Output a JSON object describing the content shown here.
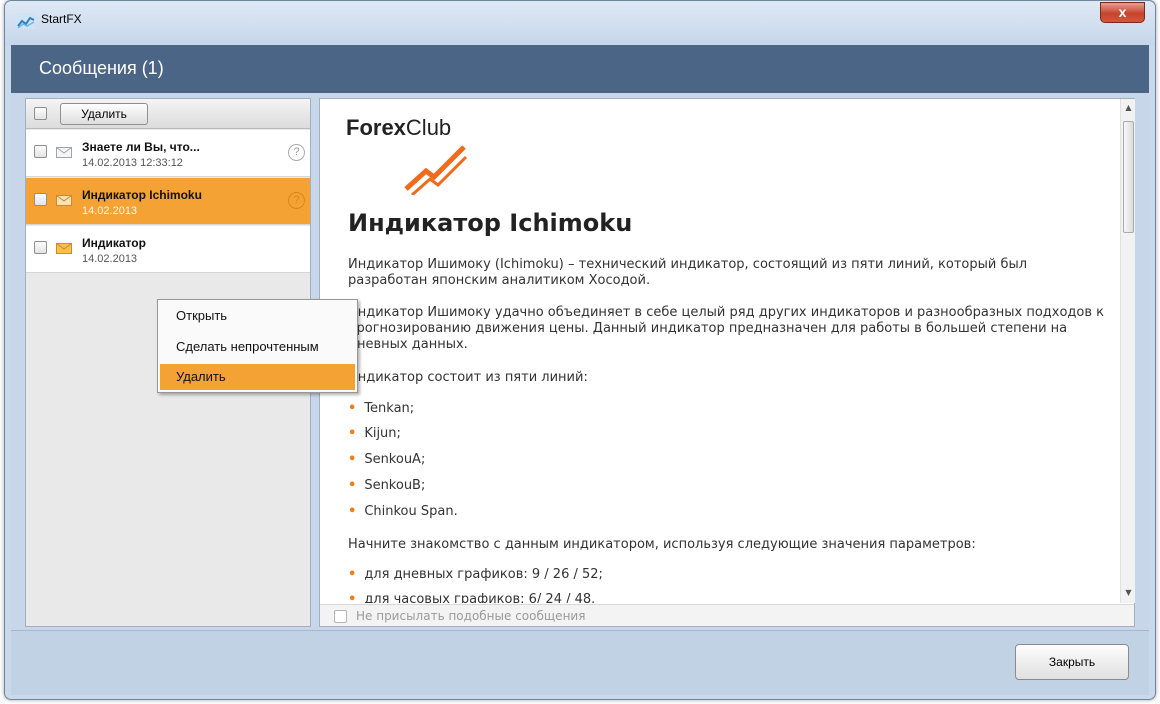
{
  "window": {
    "app_title": "StartFX",
    "close_glyph": "x"
  },
  "header": {
    "title": "Сообщения (1)"
  },
  "list": {
    "delete_label": "Удалить",
    "items": [
      {
        "title": "Знаете ли Вы, что...",
        "date": "14.02.2013 12:33:12",
        "icon": "envelope-open-icon"
      },
      {
        "title": "Индикатор Ichimoku",
        "date": "14.02.2013",
        "icon": "envelope-open-icon"
      },
      {
        "title": "Индикатор",
        "date": "14.02.2013",
        "icon": "envelope-closed-icon"
      }
    ],
    "help_glyph": "?"
  },
  "context_menu": {
    "items": [
      {
        "label": "Открыть"
      },
      {
        "label": "Сделать непрочтенным"
      },
      {
        "label": "Удалить"
      }
    ]
  },
  "content": {
    "logo_bold": "Forex",
    "logo_regular": "Club",
    "heading": "Индикатор Ichimoku",
    "p1": "Индикатор Ишимоку (Ichimoku) – технический индикатор, состоящий из пяти линий, который был разработан японским аналитиком Хосодой.",
    "p2": "Индикатор Ишимоку удачно объединяет в себе целый ряд других индикаторов и разнообразных подходов к прогнозированию движения цены. Данный индикатор предназначен для работы в большей степени на дневных данных.",
    "p3": "Индикатор состоит из пяти линий:",
    "lines": [
      "Tenkan;",
      "Kijun;",
      "SenkouA;",
      "SenkouB;",
      "Chinkou Span."
    ],
    "p4": "Начните знакомство с данным индикатором, используя следующие значения параметров:",
    "params": [
      "для дневных графиков: 9 / 26 / 52;",
      "для часовых графиков: 6/ 24 / 48."
    ],
    "dont_send_label": "Не присылать подобные сообщения"
  },
  "footer": {
    "close_label": "Закрыть"
  },
  "colors": {
    "accent": "#f4a233",
    "header": "#4b6586",
    "bullet": "#f07d18"
  }
}
